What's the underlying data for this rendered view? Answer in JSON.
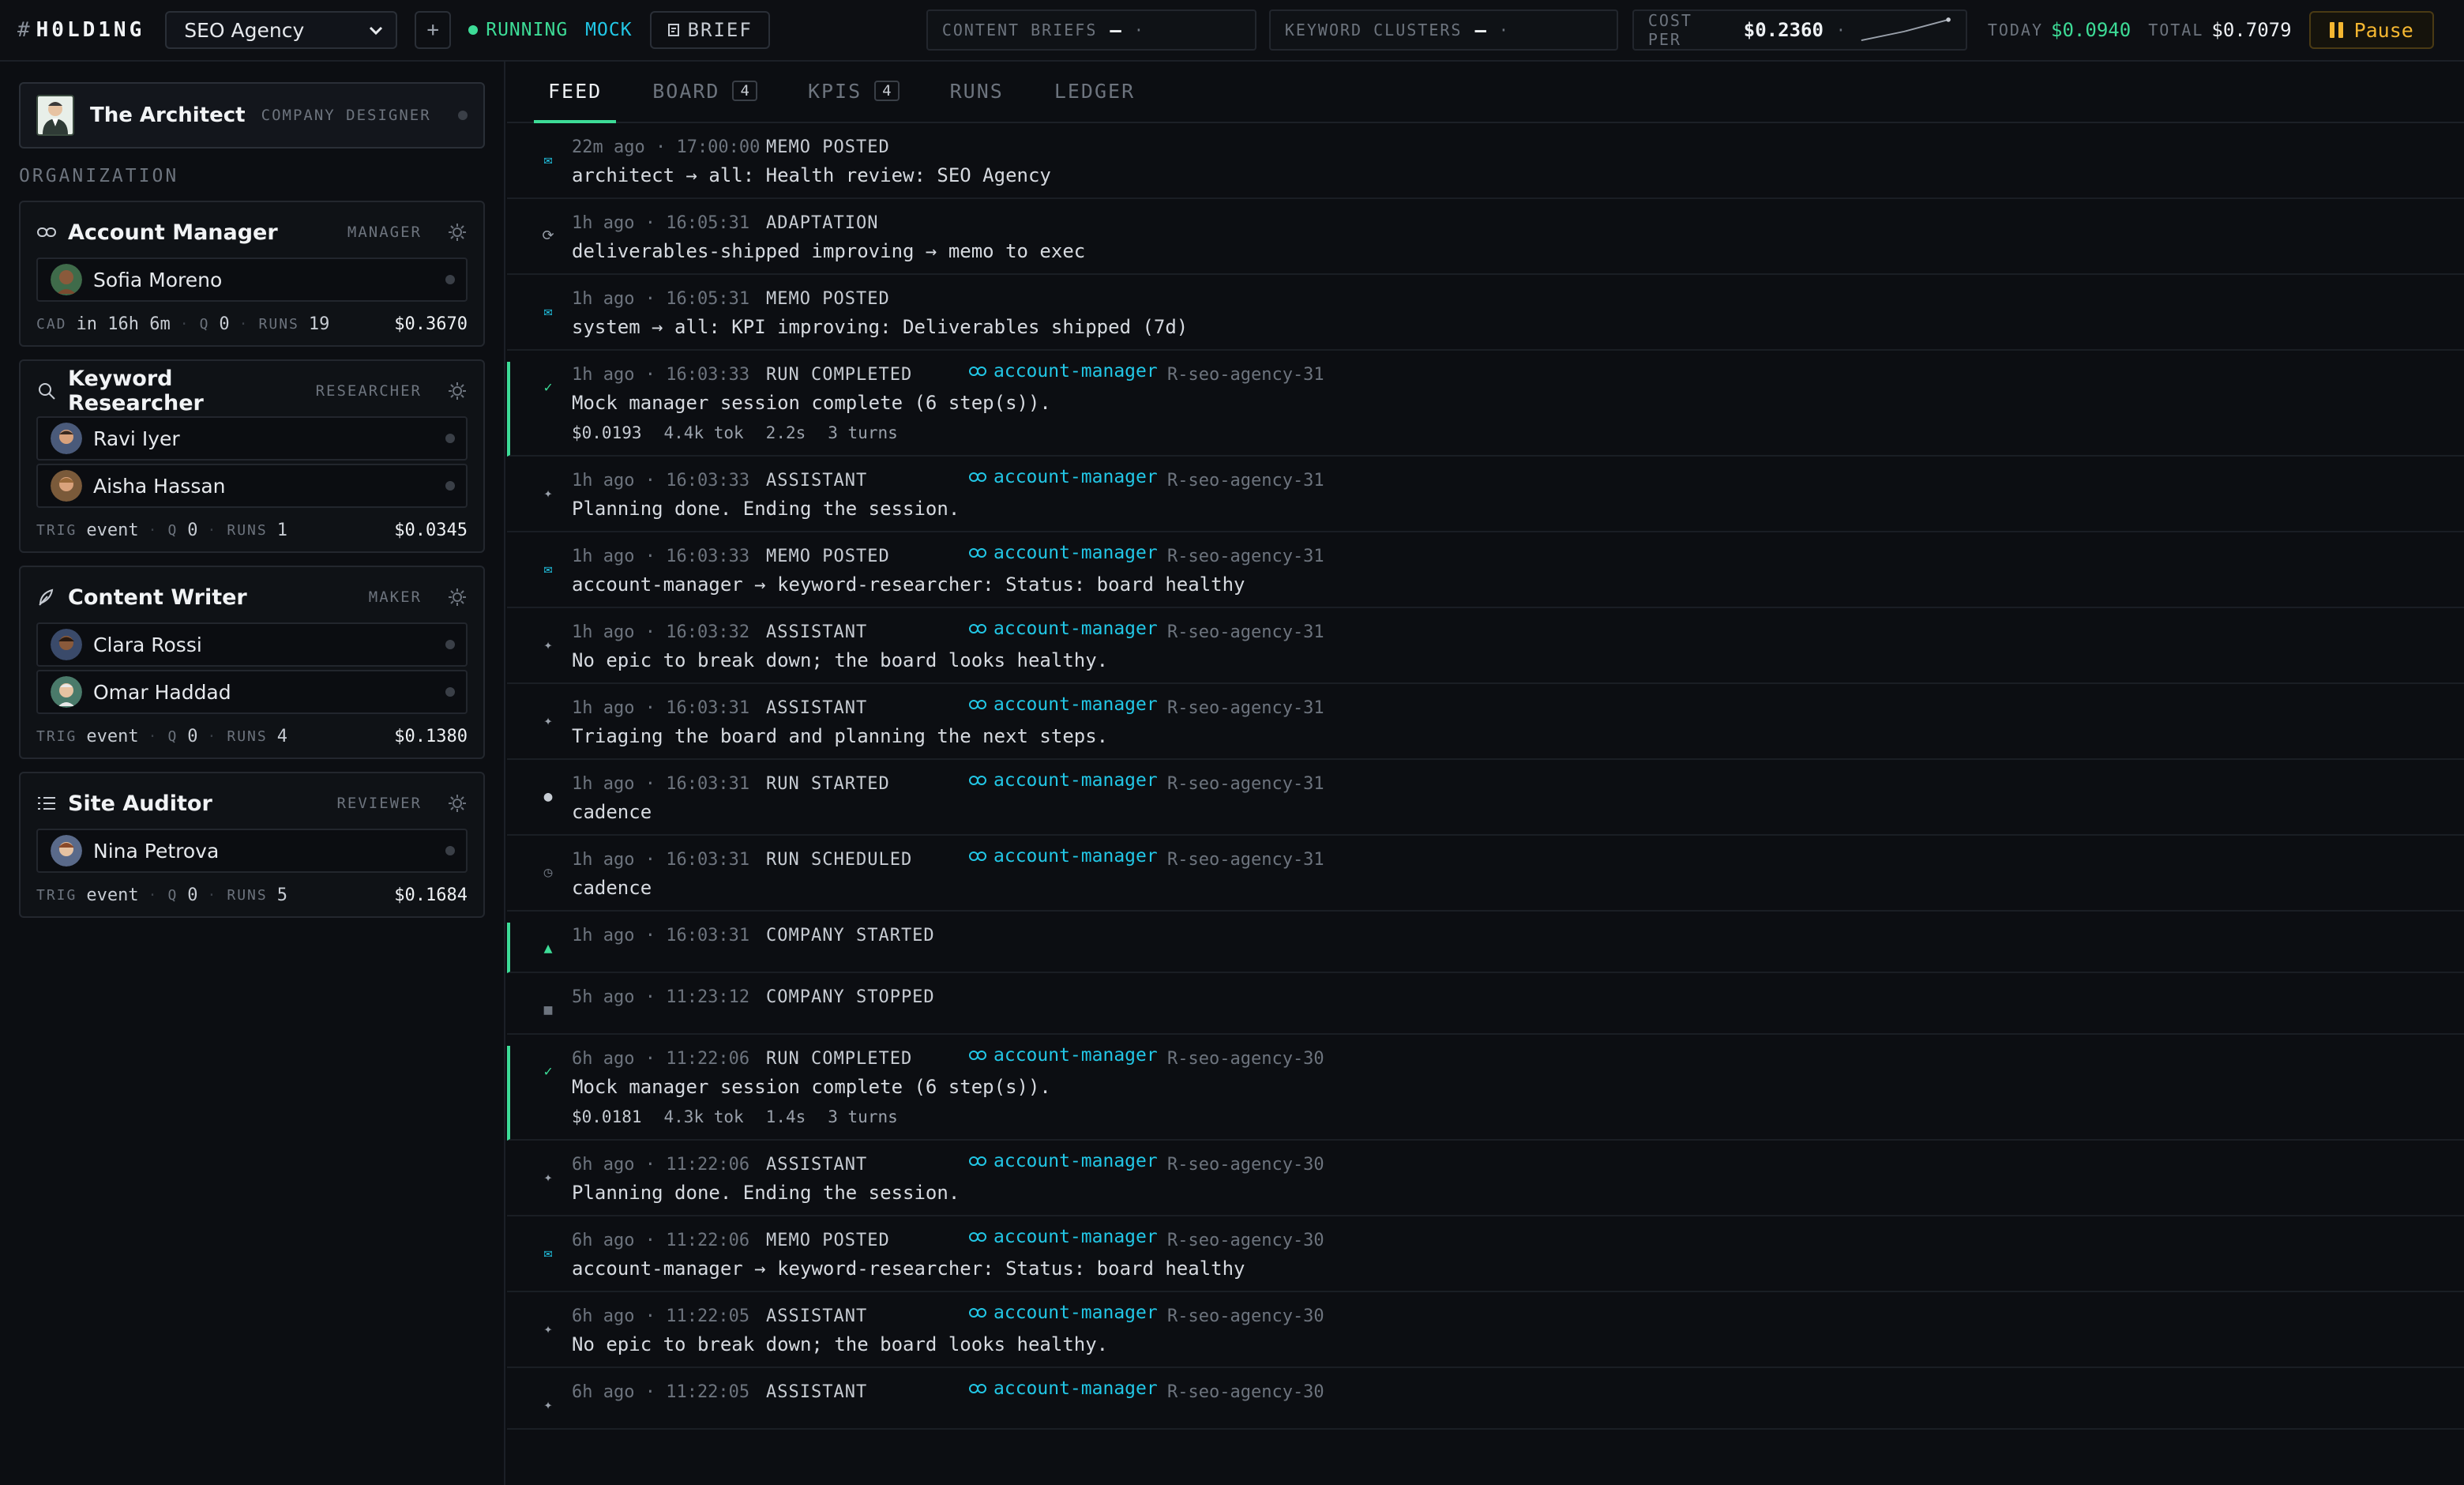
{
  "topbar": {
    "hash": "#",
    "logo": "H0LD1NG",
    "company": "SEO Agency",
    "plus": "+",
    "status": "RUNNING",
    "mode": "MOCK",
    "brief": "BRIEF",
    "content_briefs_label": "CONTENT BRIEFS",
    "content_briefs_value": "—",
    "content_briefs_trend": "·",
    "keyword_clusters_label": "KEYWORD CLUSTERS",
    "keyword_clusters_value": "—",
    "keyword_clusters_trend": "·",
    "cost_per_label": "COST PER",
    "cost_per_value": "$0.2360",
    "cost_per_trend": "·",
    "today_label": "TODAY",
    "today_value": "$0.0940",
    "total_label": "TOTAL",
    "total_value": "$0.7079",
    "pause": "Pause"
  },
  "colors": {
    "accent": "#3ddc97",
    "agent": "#22c7e6",
    "warn": "#f5b731"
  },
  "sidebar": {
    "architect_name": "The Architect",
    "architect_role": "COMPANY DESIGNER",
    "org_label": "ORGANIZATION",
    "teams": [
      {
        "name": "Account Manager",
        "type": "MANAGER",
        "icon": "link-icon",
        "members": [
          "Sofia Moreno"
        ],
        "foot_label": "CAD",
        "foot_value": "in 16h 6m",
        "q_label": "Q",
        "q_value": "0",
        "runs_label": "RUNS",
        "runs_value": "19",
        "cost": "$0.3670"
      },
      {
        "name": "Keyword Researcher",
        "type": "RESEARCHER",
        "icon": "search-icon",
        "members": [
          "Ravi Iyer",
          "Aisha Hassan"
        ],
        "foot_label": "TRIG",
        "foot_value": "event",
        "q_label": "Q",
        "q_value": "0",
        "runs_label": "RUNS",
        "runs_value": "1",
        "cost": "$0.0345"
      },
      {
        "name": "Content Writer",
        "type": "MAKER",
        "icon": "feather-icon",
        "members": [
          "Clara Rossi",
          "Omar Haddad"
        ],
        "foot_label": "TRIG",
        "foot_value": "event",
        "q_label": "Q",
        "q_value": "0",
        "runs_label": "RUNS",
        "runs_value": "4",
        "cost": "$0.1380"
      },
      {
        "name": "Site Auditor",
        "type": "REVIEWER",
        "icon": "checklist-icon",
        "members": [
          "Nina Petrova"
        ],
        "foot_label": "TRIG",
        "foot_value": "event",
        "q_label": "Q",
        "q_value": "0",
        "runs_label": "RUNS",
        "runs_value": "5",
        "cost": "$0.1684"
      }
    ]
  },
  "tabs": [
    {
      "label": "FEED",
      "badge": ""
    },
    {
      "label": "BOARD",
      "badge": "4"
    },
    {
      "label": "KPIS",
      "badge": "4"
    },
    {
      "label": "RUNS",
      "badge": ""
    },
    {
      "label": "LEDGER",
      "badge": ""
    }
  ],
  "feed": [
    {
      "icon": "✉",
      "time": "22m ago · 17:00:00",
      "kind": "MEMO POSTED",
      "agent": "",
      "ref": "",
      "msg": "architect → all: Health review: SEO Agency"
    },
    {
      "icon": "⟳",
      "time": "1h ago · 16:05:31",
      "kind": "ADAPTATION",
      "agent": "",
      "ref": "",
      "msg": "deliverables-shipped improving → memo to exec"
    },
    {
      "icon": "✉",
      "time": "1h ago · 16:05:31",
      "kind": "MEMO POSTED",
      "agent": "",
      "ref": "",
      "msg": "system → all: KPI improving: Deliverables shipped (7d)"
    },
    {
      "icon": "✓",
      "time": "1h ago · 16:03:33",
      "kind": "RUN COMPLETED",
      "agent": "account-manager",
      "ref": "R-seo-agency-31",
      "msg": "Mock manager session complete (6 step(s)).",
      "accent": true,
      "stats": [
        "$0.0193",
        "4.4k tok",
        "2.2s",
        "3 turns"
      ]
    },
    {
      "icon": "✦",
      "time": "1h ago · 16:03:33",
      "kind": "ASSISTANT",
      "agent": "account-manager",
      "ref": "R-seo-agency-31",
      "msg": "Planning done. Ending the session."
    },
    {
      "icon": "✉",
      "time": "1h ago · 16:03:33",
      "kind": "MEMO POSTED",
      "agent": "account-manager",
      "ref": "R-seo-agency-31",
      "msg": "account-manager → keyword-researcher: Status: board healthy"
    },
    {
      "icon": "✦",
      "time": "1h ago · 16:03:32",
      "kind": "ASSISTANT",
      "agent": "account-manager",
      "ref": "R-seo-agency-31",
      "msg": "No epic to break down; the board looks healthy."
    },
    {
      "icon": "✦",
      "time": "1h ago · 16:03:31",
      "kind": "ASSISTANT",
      "agent": "account-manager",
      "ref": "R-seo-agency-31",
      "msg": "Triaging the board and planning the next steps."
    },
    {
      "icon": "●",
      "time": "1h ago · 16:03:31",
      "kind": "RUN STARTED",
      "agent": "account-manager",
      "ref": "R-seo-agency-31",
      "msg": "cadence"
    },
    {
      "icon": "◷",
      "time": "1h ago · 16:03:31",
      "kind": "RUN SCHEDULED",
      "agent": "account-manager",
      "ref": "R-seo-agency-31",
      "msg": "cadence"
    },
    {
      "icon": "▲",
      "time": "1h ago · 16:03:31",
      "kind": "COMPANY STARTED",
      "agent": "",
      "ref": "",
      "msg": "",
      "accent": true
    },
    {
      "icon": "■",
      "time": "5h ago · 11:23:12",
      "kind": "COMPANY STOPPED",
      "agent": "",
      "ref": "",
      "msg": ""
    },
    {
      "icon": "✓",
      "time": "6h ago · 11:22:06",
      "kind": "RUN COMPLETED",
      "agent": "account-manager",
      "ref": "R-seo-agency-30",
      "msg": "Mock manager session complete (6 step(s)).",
      "accent": true,
      "stats": [
        "$0.0181",
        "4.3k tok",
        "1.4s",
        "3 turns"
      ]
    },
    {
      "icon": "✦",
      "time": "6h ago · 11:22:06",
      "kind": "ASSISTANT",
      "agent": "account-manager",
      "ref": "R-seo-agency-30",
      "msg": "Planning done. Ending the session."
    },
    {
      "icon": "✉",
      "time": "6h ago · 11:22:06",
      "kind": "MEMO POSTED",
      "agent": "account-manager",
      "ref": "R-seo-agency-30",
      "msg": "account-manager → keyword-researcher: Status: board healthy"
    },
    {
      "icon": "✦",
      "time": "6h ago · 11:22:05",
      "kind": "ASSISTANT",
      "agent": "account-manager",
      "ref": "R-seo-agency-30",
      "msg": "No epic to break down; the board looks healthy."
    },
    {
      "icon": "✦",
      "time": "6h ago · 11:22:05",
      "kind": "ASSISTANT",
      "agent": "account-manager",
      "ref": "R-seo-agency-30",
      "msg": ""
    }
  ]
}
